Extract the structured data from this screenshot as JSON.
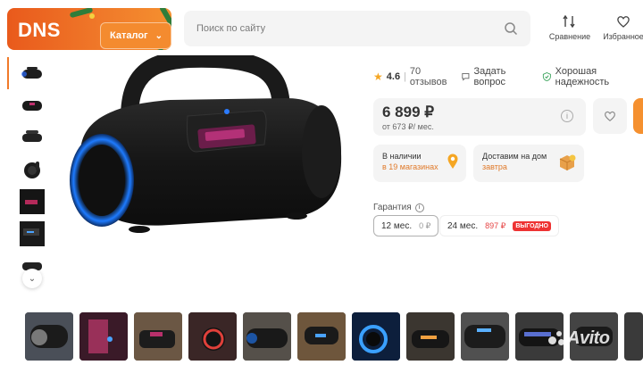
{
  "header": {
    "logo": "DNS",
    "catalog_label": "Каталог",
    "search_placeholder": "Поиск по сайту",
    "compare_label": "Сравнение",
    "favorites_label": "Избранное"
  },
  "product": {
    "rating": "4.6",
    "reviews": "70 отзывов",
    "ask_question": "Задать вопрос",
    "reliability": "Хорошая надежность",
    "price": "6 899 ₽",
    "installment": "от 673 ₽/ мес.",
    "availability_title": "В наличии",
    "availability_link": "в 19 магазинах",
    "delivery_title": "Доставим на дом",
    "delivery_link": "завтра",
    "warranty_title": "Гарантия",
    "warranty_options": [
      {
        "label": "12 мес.",
        "price": "0 ₽",
        "selected": true
      },
      {
        "label": "24 мес.",
        "price": "897 ₽",
        "badge": "ВЫГОДНО",
        "selected": false
      }
    ]
  },
  "thumbnails": {
    "vertical_count": 7,
    "bottom_count": 12
  },
  "watermark": "Avito",
  "colors": {
    "brand_orange": "#f07a2a",
    "accent_link": "#e07a2a",
    "badge_red": "#e33333",
    "panel_bg": "#f4f4f4"
  }
}
